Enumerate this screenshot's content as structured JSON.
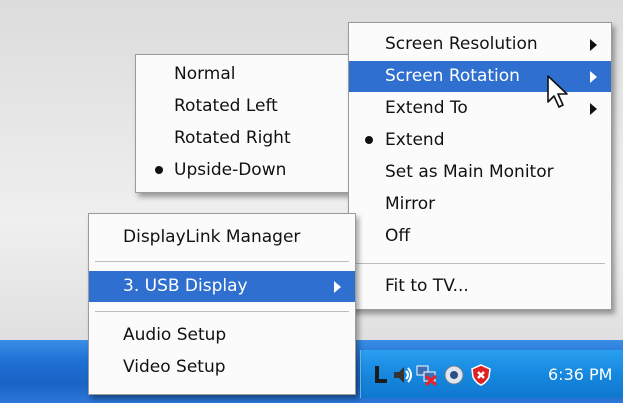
{
  "main_menu": {
    "items": [
      {
        "label": "Screen Resolution",
        "submenu": true
      },
      {
        "label": "Screen Rotation",
        "submenu": true,
        "highlighted": true
      },
      {
        "label": "Extend To",
        "submenu": true
      },
      {
        "label": "Extend",
        "checked": true
      },
      {
        "label": "Set as Main Monitor"
      },
      {
        "label": "Mirror"
      },
      {
        "label": "Off"
      },
      {
        "label": "Fit to TV..."
      }
    ]
  },
  "rotation_menu": {
    "items": [
      {
        "label": "Normal"
      },
      {
        "label": "Rotated Left"
      },
      {
        "label": "Rotated Right"
      },
      {
        "label": "Upside-Down",
        "checked": true
      }
    ]
  },
  "tray_menu": {
    "items": [
      {
        "label": "DisplayLink Manager"
      },
      {
        "label": "3. USB Display",
        "submenu": true,
        "highlighted": true
      },
      {
        "label": "Audio Setup"
      },
      {
        "label": "Video Setup"
      }
    ]
  },
  "taskbar": {
    "clock": "6:36 PM",
    "tray_icons": [
      "displaylink-icon",
      "volume-icon",
      "network-disconnected-icon",
      "update-icon",
      "security-alert-icon"
    ]
  },
  "colors": {
    "highlight": "#2f6fcf",
    "taskbar": "#1d6fd3",
    "menu_bg": "#fbfbfb"
  }
}
